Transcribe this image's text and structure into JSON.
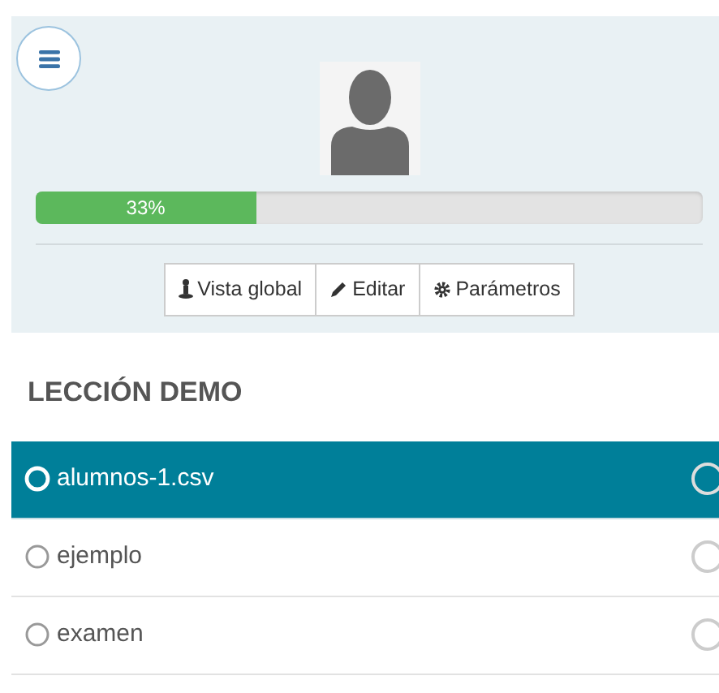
{
  "progress": {
    "level": 0.33,
    "label": "33%"
  },
  "actions": [
    "Vista global",
    "Editar",
    "Parámetros"
  ],
  "lesson_title": "LECCIÓN DEMO",
  "items": [
    {
      "label": "alumnos-1.csv",
      "selected": true
    },
    {
      "label": "ejemplo",
      "selected": false
    },
    {
      "label": "examen",
      "selected": false
    }
  ]
}
